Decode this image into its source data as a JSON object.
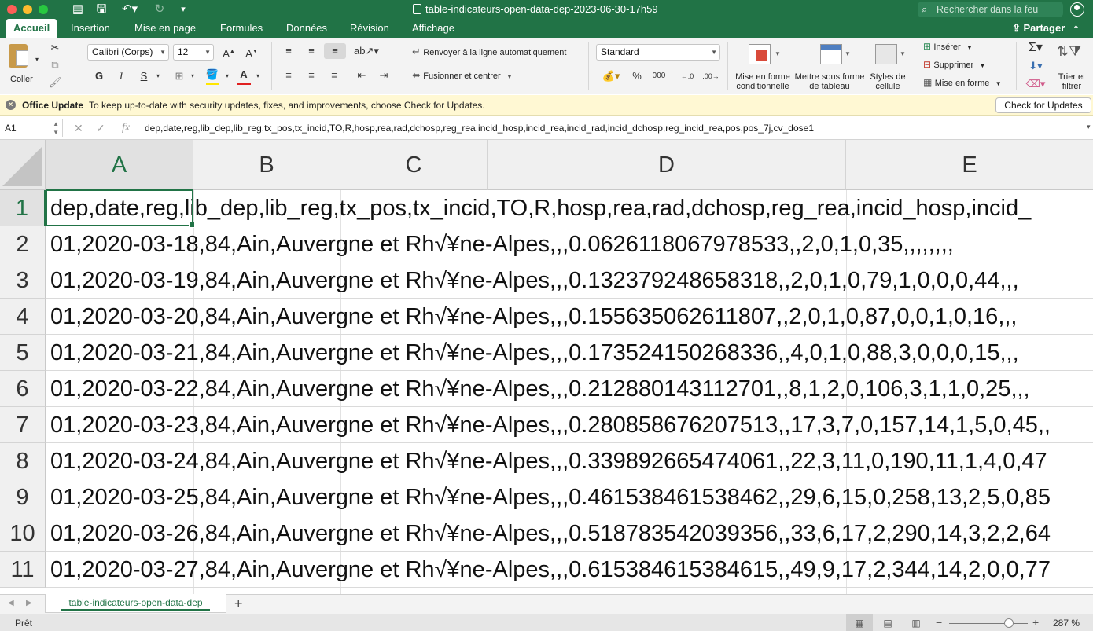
{
  "window": {
    "title": "table-indicateurs-open-data-dep-2023-06-30-17h59",
    "search_placeholder": "Rechercher dans la feu"
  },
  "tabs": [
    "Accueil",
    "Insertion",
    "Mise en page",
    "Formules",
    "Données",
    "Révision",
    "Affichage"
  ],
  "active_tab": "Accueil",
  "share_label": "Partager",
  "ribbon": {
    "paste_label": "Coller",
    "font_name": "Calibri (Corps)",
    "font_size": "12",
    "wrap_text": "Renvoyer à la ligne automatiquement",
    "merge_center": "Fusionner et centrer",
    "number_format": "Standard",
    "conditional_format": "Mise en forme conditionnelle",
    "format_table": "Mettre sous forme de tableau",
    "cell_styles": "Styles de cellule",
    "insert": "Insérer",
    "delete": "Supprimer",
    "format": "Mise en forme",
    "sort_filter": "Trier et filtrer",
    "highlight_color": "#ffe600",
    "font_color": "#e02020"
  },
  "message_bar": {
    "title": "Office Update",
    "text": "To keep up-to-date with security updates, fixes, and improvements, choose Check for Updates.",
    "button": "Check for Updates"
  },
  "formula_bar": {
    "name_box": "A1",
    "formula": "dep,date,reg,lib_dep,lib_reg,tx_pos,tx_incid,TO,R,hosp,rea,rad,dchosp,reg_rea,incid_hosp,incid_rea,incid_rad,incid_dchosp,reg_incid_rea,pos,pos_7j,cv_dose1"
  },
  "columns": [
    "A",
    "B",
    "C",
    "D",
    "E"
  ],
  "rows": [
    {
      "num": "1",
      "text": "dep,date,reg,lib_dep,lib_reg,tx_pos,tx_incid,TO,R,hosp,rea,rad,dchosp,reg_rea,incid_hosp,incid_"
    },
    {
      "num": "2",
      "text": "01,2020-03-18,84,Ain,Auvergne et Rh√¥ne-Alpes,,,0.0626118067978533,,2,0,1,0,35,,,,,,,,"
    },
    {
      "num": "3",
      "text": "01,2020-03-19,84,Ain,Auvergne et Rh√¥ne-Alpes,,,0.132379248658318,,2,0,1,0,79,1,0,0,0,44,,,"
    },
    {
      "num": "4",
      "text": "01,2020-03-20,84,Ain,Auvergne et Rh√¥ne-Alpes,,,0.155635062611807,,2,0,1,0,87,0,0,1,0,16,,,"
    },
    {
      "num": "5",
      "text": "01,2020-03-21,84,Ain,Auvergne et Rh√¥ne-Alpes,,,0.173524150268336,,4,0,1,0,88,3,0,0,0,15,,,"
    },
    {
      "num": "6",
      "text": "01,2020-03-22,84,Ain,Auvergne et Rh√¥ne-Alpes,,,0.212880143112701,,8,1,2,0,106,3,1,1,0,25,,,"
    },
    {
      "num": "7",
      "text": "01,2020-03-23,84,Ain,Auvergne et Rh√¥ne-Alpes,,,0.280858676207513,,17,3,7,0,157,14,1,5,0,45,,"
    },
    {
      "num": "8",
      "text": "01,2020-03-24,84,Ain,Auvergne et Rh√¥ne-Alpes,,,0.339892665474061,,22,3,11,0,190,11,1,4,0,47"
    },
    {
      "num": "9",
      "text": "01,2020-03-25,84,Ain,Auvergne et Rh√¥ne-Alpes,,,0.461538461538462,,29,6,15,0,258,13,2,5,0,85"
    },
    {
      "num": "10",
      "text": "01,2020-03-26,84,Ain,Auvergne et Rh√¥ne-Alpes,,,0.518783542039356,,33,6,17,2,290,14,3,2,2,64"
    },
    {
      "num": "11",
      "text": "01,2020-03-27,84,Ain,Auvergne et Rh√¥ne-Alpes,,,0.615384615384615,,49,9,17,2,344,14,2,0,0,77"
    }
  ],
  "sheet_tab": "table-indicateurs-open-data-dep",
  "status": "Prêt",
  "zoom": "287 %",
  "zoom_level": 0.76
}
